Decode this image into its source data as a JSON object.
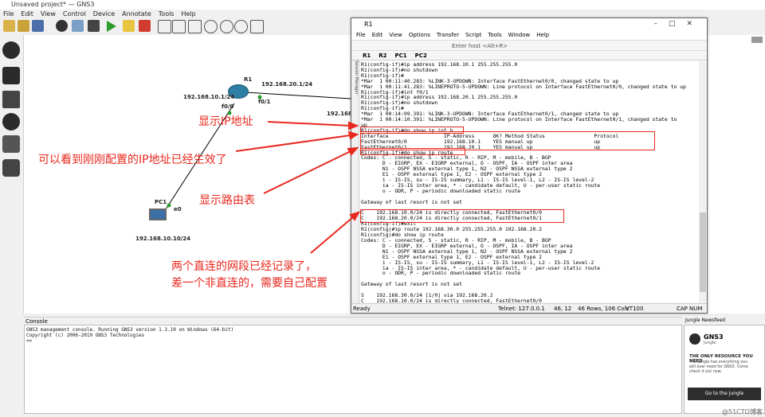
{
  "app": {
    "title": "Unsaved project* — GNS3",
    "menu": [
      "File",
      "Edit",
      "View",
      "Control",
      "Device",
      "Annotate",
      "Tools",
      "Help"
    ]
  },
  "topology": {
    "router_name": "R1",
    "router_ip_f01": "192.168.20.1/24",
    "router_ip_f00": "192.168.10.1/24",
    "port_f00": "f0/0",
    "port_f01": "f0/1",
    "link_right_ip": "192.168",
    "pc_name": "PC1",
    "pc_port": "e0",
    "pc_ip": "192.168.10.10/24"
  },
  "annotations": {
    "show_ip": "显示IP地址",
    "ip_effective": "可以看到刚刚配置的IP地址已经生效了",
    "show_route": "显示路由表",
    "direct_1": "两个直连的网段已经记录了，",
    "direct_2": "差一个非直连的，需要自己配置"
  },
  "console": {
    "title": "Console",
    "lines": [
      "GNS3 management console. Running GNS3 version 1.3.10 on Windows (64-bit)",
      "Copyright (c) 2006-2019 GNS3 Technologies",
      "",
      "=>"
    ]
  },
  "jungle": {
    "title": "Jungle Newsfeed",
    "brand": "GNS3",
    "sub": "Jungle",
    "headline": "THE ONLY RESOURCE YOU NEED",
    "body": "The Jungle has everything you will ever need for GNS3. Come check it out now.",
    "button": "Go to the Jungle"
  },
  "terminal": {
    "title": "R1",
    "menu": [
      "File",
      "Edit",
      "View",
      "Options",
      "Transfer",
      "Script",
      "Tools",
      "Window",
      "Help"
    ],
    "host_placeholder": "Enter host <Alt+R>",
    "tabs": [
      "R1",
      "R2",
      "PC1",
      "PC2"
    ],
    "side_label": "Session Manager",
    "lines": [
      "R1(config-if)#ip address 192.168.10.1 255.255.255.0",
      "R1(config-if)#no shutdown",
      "R1(config-if)#",
      "*Mar  1 00:11:40.283: %LINK-3-UPDOWN: Interface FastEthernet0/0, changed state to up",
      "*Mar  1 00:11:41.283: %LINEPROTO-5-UPDOWN: Line protocol on Interface FastEthernet0/0, changed state to up",
      "R1(config-if)#int f0/1",
      "R1(config-if)#ip address 192.168.20.1 255.255.255.0",
      "R1(config-if)#no shutdown",
      "R1(config-if)#",
      "*Mar  1 00:14:09.391: %LINK-3-UPDOWN: Interface FastEthernet0/1, changed state to up",
      "*Mar  1 00:14:10.391: %LINEPROTO-5-UPDOWN: Line protocol on Interface FastEthernet0/1, changed state to",
      "up",
      "R1(config-if)#do show ip int b",
      "Interface                  IP-Address      OK? Method Status                Protocol",
      "FastEthernet0/0            192.168.10.1    YES manual up                    up",
      "FastEthernet0/1            192.168.20.1    YES manual up                    up",
      "R1(config-if)#do show ip route",
      "Codes: C - connected, S - static, R - RIP, M - mobile, B - BGP",
      "       D - EIGRP, EX - EIGRP external, O - OSPF, IA - OSPF inter area",
      "       N1 - OSPF NSSA external type 1, N2 - OSPF NSSA external type 2",
      "       E1 - OSPF external type 1, E2 - OSPF external type 2",
      "       i - IS-IS, su - IS-IS summary, L1 - IS-IS level-1, L2 - IS-IS level-2",
      "       ia - IS-IS inter area, * - candidate default, U - per-user static route",
      "       o - ODR, P - periodic downloaded static route",
      "",
      "Gateway of last resort is not set",
      "",
      "C    192.168.10.0/24 is directly connected, FastEthernet0/0",
      "C    192.168.20.0/24 is directly connected, FastEthernet0/1",
      "R1(config-if)#exit",
      "R1(config)#ip route 192.168.30.0 255.255.255.0 192.168.20.2",
      "R1(config)#do show ip route",
      "Codes: C - connected, S - static, R - RIP, M - mobile, B - BGP",
      "       D - EIGRP, EX - EIGRP external, O - OSPF, IA - OSPF inter area",
      "       N1 - OSPF NSSA external type 1, N2 - OSPF NSSA external type 2",
      "       E1 - OSPF external type 1, E2 - OSPF external type 2",
      "       i - IS-IS, su - IS-IS summary, L1 - IS-IS level-1, L2 - IS-IS level-2",
      "       ia - IS-IS inter area, * - candidate default, U - per-user static route",
      "       o - ODR, P - periodic downloaded static route",
      "",
      "Gateway of last resort is not set",
      "",
      "S    192.168.30.0/24 [1/0] via 192.168.20.2",
      "C    192.168.10.0/24 is directly connected, FastEthernet0/0",
      "C    192.168.20.0/24 is directly connected, FastEthernet0/1",
      "R1(config)#"
    ],
    "status": {
      "ready": "Ready",
      "telnet": "Telnet: 127.0.0.1",
      "pos": "46, 12",
      "size": "46 Rows, 106 Cols",
      "term": "VT100",
      "caps": "CAP",
      "num": "NUM"
    }
  },
  "watermark": "@51CTO博客"
}
